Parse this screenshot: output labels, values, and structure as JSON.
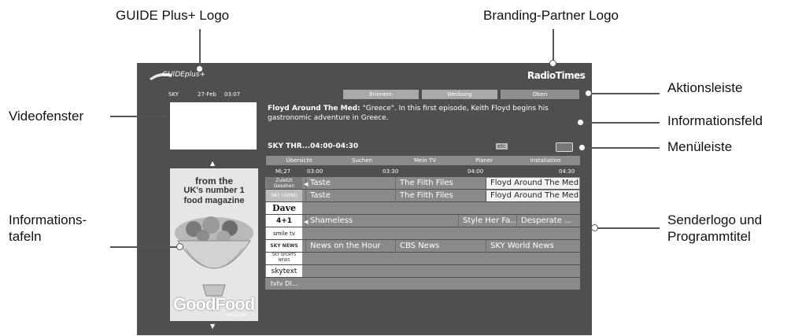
{
  "callouts": {
    "guide_logo": "GUIDE Plus+ Logo",
    "partner_logo": "Branding-Partner Logo",
    "aktionsleiste": "Aktionsleiste",
    "videofenster": "Videofenster",
    "informationsfeld": "Informationsfeld",
    "menuleiste": "Menüleiste",
    "infotafeln_1": "Informations-",
    "infotafeln_2": "tafeln",
    "senderlogo_1": "Senderlogo und",
    "senderlogo_2": "Programmtitel"
  },
  "screen": {
    "guide_logo_text": "GUIDEplus+",
    "partner_logo_text": "RadioTimes",
    "channel": "SKY",
    "date": "27-Feb",
    "time": "03:07",
    "action_buttons": [
      "Erinnern",
      "Werbung",
      "Oben"
    ],
    "info_title": "Floyd Around The Med:",
    "info_text": " \"Greece\". In this first episode, Keith Floyd begins his gastronomic adventure in Greece.",
    "selected_slot": "SKY THR...04:00-04:30",
    "rating_icon": "etc",
    "menu": [
      "Übersicht",
      "Suchen",
      "Mein TV",
      "Planer",
      "Installation"
    ],
    "timeline": {
      "day": "Mi,27",
      "times": [
        "03:00",
        "03:30",
        "04:00",
        "04:30"
      ]
    },
    "ad": {
      "line1": "from the",
      "line2": "UK's number 1",
      "line3": "food magazine",
      "brand": "GoodFood",
      "brand_sub": "MAGAZINE"
    },
    "channels": [
      {
        "logo": "Zuletzt Gesehen"
      },
      {
        "logo": "SKY LIVING"
      },
      {
        "logo": "Dave"
      },
      {
        "logo": "4+1"
      },
      {
        "logo": "smile tv"
      },
      {
        "logo": "SKY NEWS"
      },
      {
        "logo": "SKY SPORTS NEWS"
      },
      {
        "logo": "skytext"
      },
      {
        "logo": "tvtv DI..."
      }
    ],
    "programmes": {
      "r0": [
        "Taste",
        "The Filth Files",
        "Floyd Around The Med"
      ],
      "r1": [
        "Taste",
        "The Filth Files",
        "Floyd Around The Med"
      ],
      "r3": [
        "Shameless",
        "Style Her Fa...",
        "Desperate ..."
      ],
      "r5": [
        "News on the Hour",
        "CBS News",
        "SKY World News"
      ]
    }
  },
  "colors": {
    "screen_bg": "#4f4f4f",
    "grid_row": "#8a8a8a",
    "highlight": "#f3f3f3"
  }
}
